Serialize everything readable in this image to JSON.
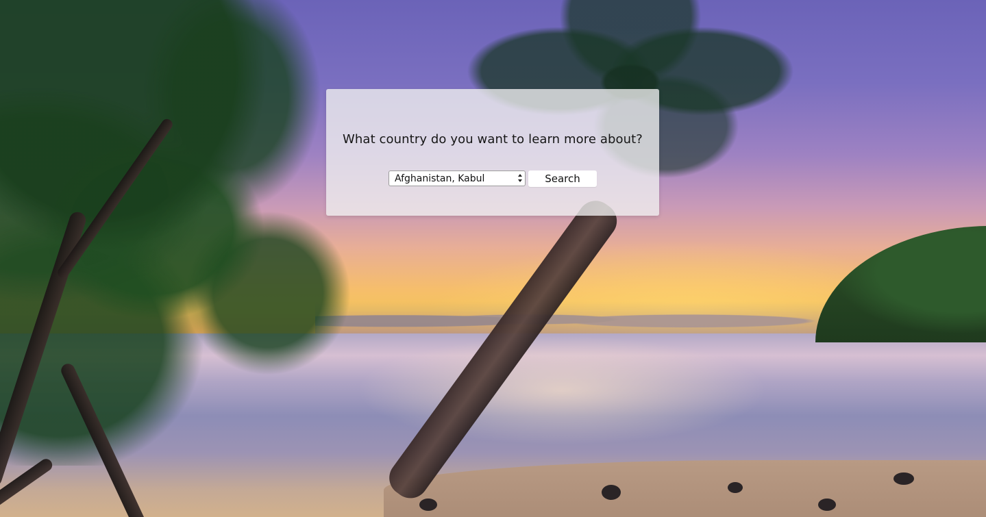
{
  "modal": {
    "question": "What country do you want to learn more about?",
    "country_select": {
      "selected": "Afghanistan, Kabul"
    },
    "search_label": "Search"
  },
  "background": {
    "description": "",
    "colors": {
      "sky_top": "#6b63b8",
      "sunset": "#f4c35d",
      "sea": "#8d8db6",
      "island": "#2d5128",
      "foliage": "#1f4e21"
    }
  }
}
